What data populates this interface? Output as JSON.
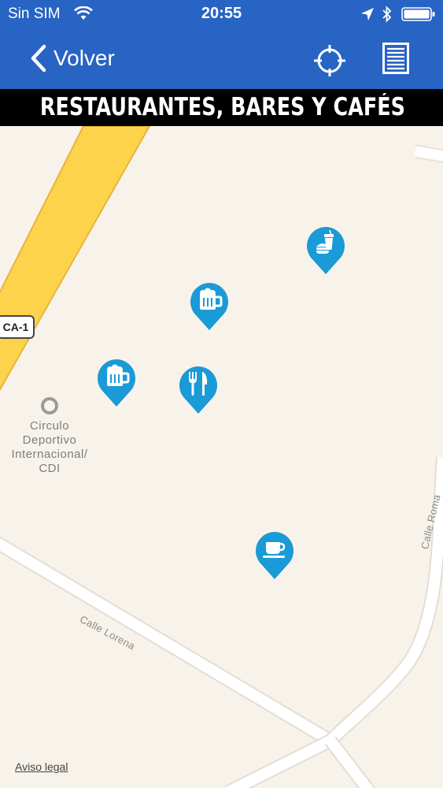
{
  "status_bar": {
    "carrier": "Sin SIM",
    "time": "20:55",
    "icons": [
      "wifi-icon",
      "location-arrow-icon",
      "bluetooth-icon",
      "battery-icon"
    ]
  },
  "nav": {
    "back_label": "Volver",
    "icons": [
      "chevron-left-icon",
      "crosshair-icon",
      "list-icon"
    ]
  },
  "banner": {
    "title": "RESTAURANTES, BARES Y CAFÉS"
  },
  "map": {
    "road_shield": "CA-1",
    "poi_label_lines": [
      "Circulo",
      "Deportivo",
      "Internacional/",
      "CDI"
    ],
    "streets": {
      "lorena": "Calle Lorena",
      "roma": "Calle Roma"
    },
    "markers": [
      {
        "type": "fast-food",
        "icon": "fast-food-icon"
      },
      {
        "type": "beer-bar",
        "icon": "beer-mug-icon"
      },
      {
        "type": "beer-bar",
        "icon": "beer-mug-icon"
      },
      {
        "type": "restaurant",
        "icon": "fork-knife-icon"
      },
      {
        "type": "cafe",
        "icon": "coffee-cup-icon"
      }
    ],
    "legal_link": "Aviso legal"
  },
  "colors": {
    "nav_blue": "#2764c4",
    "marker_blue": "#1a9ad6",
    "map_background": "#f8f3ea",
    "highway_yellow": "#fcd34b"
  }
}
